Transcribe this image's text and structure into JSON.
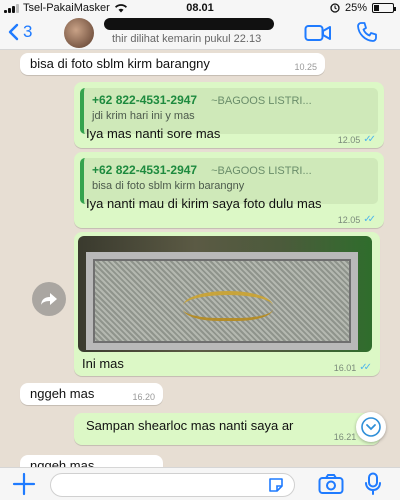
{
  "status": {
    "carrier": "Tsel-PakaiMasker",
    "time": "08.01",
    "battery": "25%",
    "battery_level": 0.25
  },
  "header": {
    "back_count": "3",
    "last_seen": "thir dilihat kemarin pukul 22.13"
  },
  "messages": [
    {
      "dir": "in",
      "text": "bisa di foto sblm kirm barangny",
      "time": "10.25"
    },
    {
      "dir": "out",
      "quote_phone": "+62 822-4531-2947",
      "quote_name": "~BAGOOS LISTRI...",
      "quote_text": "jdi krim hari ini y mas",
      "text": "Iya mas nanti sore mas",
      "time": "12.05"
    },
    {
      "dir": "out",
      "quote_phone": "+62 822-4531-2947",
      "quote_name": "~BAGOOS LISTRI...",
      "quote_text": "bisa di foto sblm kirm barangny",
      "text": "Iya nanti mau di kirim saya foto dulu mas",
      "time": "12.05"
    },
    {
      "dir": "out",
      "type": "photo",
      "text": "Ini mas",
      "time": "16.01"
    },
    {
      "dir": "in",
      "text": "nggeh mas",
      "time": "16.20"
    },
    {
      "dir": "out",
      "text": "Sampan shearloc mas nanti saya ar",
      "time": "16.21"
    },
    {
      "dir": "in",
      "text": "nggeh mas"
    }
  ],
  "colors": {
    "accent": "#1f7bff",
    "outgoing": "#dcf8c6",
    "incoming": "#ffffff",
    "read_ticks": "#4fb6ec"
  }
}
